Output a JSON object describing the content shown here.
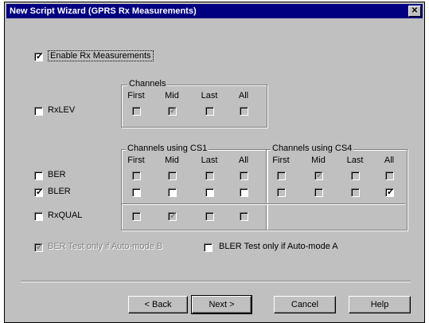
{
  "window": {
    "title": "New Script Wizard (GPRS Rx Measurements)",
    "close_glyph": "✕"
  },
  "enable_rx": {
    "label": "Enable Rx Measurements",
    "checked": true
  },
  "columns": [
    "First",
    "Mid",
    "Last",
    "All"
  ],
  "groups": {
    "channels": "Channels",
    "cs1": "Channels using CS1",
    "cs4": "Channels using CS4"
  },
  "rows": {
    "rxlev": {
      "label": "RxLEV",
      "checked": false
    },
    "ber": {
      "label": "BER",
      "checked": false
    },
    "bler": {
      "label": "BLER",
      "checked": true
    },
    "rxqual": {
      "label": "RxQUAL",
      "checked": false
    }
  },
  "ber_test": {
    "label": "BER Test only if Auto-mode B",
    "checked": true,
    "disabled": true
  },
  "bler_test": {
    "label": "BLER Test only if Auto-mode A",
    "checked": false
  },
  "buttons": {
    "back": "< Back",
    "next": "Next >",
    "cancel": "Cancel",
    "help": "Help"
  }
}
